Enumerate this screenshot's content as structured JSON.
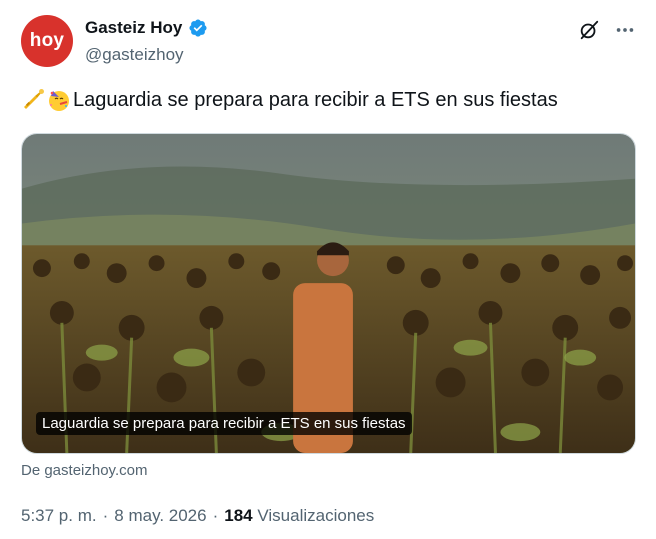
{
  "author": {
    "avatar_text": "hoy",
    "display_name": "Gasteiz Hoy",
    "handle": "@gasteizhoy",
    "verified": true,
    "avatar_color": "#d8322c",
    "verified_color": "#1d9bf0"
  },
  "header_icons": [
    "grok-icon",
    "more-options-icon"
  ],
  "tweet": {
    "emojis": [
      "trumpet-emoji",
      "partying-face-emoji"
    ],
    "text": "Laguardia se prepara para recibir a ETS en sus fiestas"
  },
  "card": {
    "caption": "Laguardia se prepara para recibir a ETS en sus fiestas",
    "source": "De gasteizhoy.com"
  },
  "meta": {
    "time": "5:37 p. m.",
    "separator1": "·",
    "date": "8 may. 2026",
    "separator2": "·",
    "views_count": "184",
    "views_label": "Visualizaciones"
  }
}
